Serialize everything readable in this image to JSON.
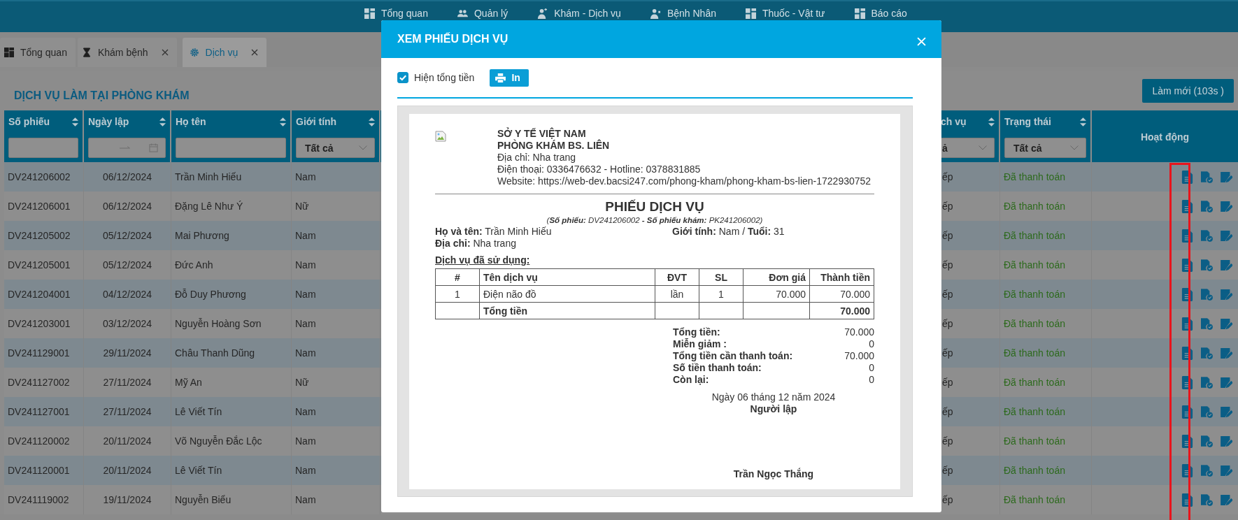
{
  "nav": [
    {
      "label": "Tổng quan"
    },
    {
      "label": "Quản lý"
    },
    {
      "label": "Khám - Dịch vụ"
    },
    {
      "label": "Bệnh Nhân"
    },
    {
      "label": "Thuốc - Vật tư"
    },
    {
      "label": "Báo cáo"
    }
  ],
  "tabs": [
    {
      "label": "Tổng quan",
      "selected": false,
      "closable": false
    },
    {
      "label": "Khám bệnh",
      "selected": false,
      "closable": true
    },
    {
      "label": "Dịch vụ",
      "selected": true,
      "closable": true
    }
  ],
  "page_title": "DỊCH VỤ LÀM TẠI PHÒNG KHÁM",
  "refresh_button": "Làm mới (103s )",
  "table": {
    "columns": [
      {
        "label": "Số phiếu",
        "kind": "text"
      },
      {
        "label": "Ngày lập",
        "kind": "date"
      },
      {
        "label": "Họ tên",
        "kind": "text"
      },
      {
        "label": "Giới tính",
        "kind": "select",
        "value": "Tất cả"
      },
      {
        "label": "ch vụ",
        "kind": "select",
        "value": "ả"
      },
      {
        "label": "Trạng thái",
        "kind": "select",
        "value": "Tất cả"
      },
      {
        "label": "Hoạt động",
        "kind": "plain"
      }
    ],
    "rows": [
      {
        "cells": [
          "DV241206002",
          "06/12/2024",
          "Trần Minh Hiếu",
          "Nam",
          "ếp",
          "Đã thanh toán"
        ]
      },
      {
        "cells": [
          "DV241206001",
          "06/12/2024",
          "Đặng Lê Như Ý",
          "Nữ",
          "ếp",
          "Đã thanh toán"
        ]
      },
      {
        "cells": [
          "DV241205002",
          "05/12/2024",
          "Mai Phương",
          "Nam",
          "ếp",
          "Đã thanh toán"
        ]
      },
      {
        "cells": [
          "DV241205001",
          "05/12/2024",
          "Đức Anh",
          "Nam",
          "ếp",
          "Đã thanh toán"
        ]
      },
      {
        "cells": [
          "DV241204001",
          "04/12/2024",
          "Đỗ Duy Phương",
          "Nam",
          "ếp",
          "Đã thanh toán"
        ]
      },
      {
        "cells": [
          "DV241203001",
          "03/12/2024",
          "Nguyễn Hoàng Sơn",
          "Nam",
          "ếp",
          "Đã thanh toán"
        ]
      },
      {
        "cells": [
          "DV241129001",
          "29/11/2024",
          "Châu Thanh Dũng",
          "Nam",
          "ếp",
          "Đã thanh toán"
        ]
      },
      {
        "cells": [
          "DV241127002",
          "27/11/2024",
          "Mỹ An",
          "Nữ",
          "ếp",
          "Đã thanh toán"
        ]
      },
      {
        "cells": [
          "DV241127001",
          "27/11/2024",
          "Lê Viết Tín",
          "Nam",
          "ếp",
          "Đã thanh toán"
        ]
      },
      {
        "cells": [
          "DV241120002",
          "20/11/2024",
          "Võ Nguyễn Đắc Lộc",
          "Nam",
          "ếp",
          "Đã thanh toán"
        ]
      },
      {
        "cells": [
          "DV241120001",
          "20/11/2024",
          "Lê Viết Tín",
          "Nam",
          "ếp",
          "Đã thanh toán"
        ]
      },
      {
        "cells": [
          "DV241119002",
          "19/11/2024",
          "Nguyễn Biểu",
          "Nam",
          "ếp",
          "Đã thanh toán"
        ]
      }
    ]
  },
  "modal": {
    "title": "XEM PHIẾU DỊCH VỤ",
    "show_total": {
      "label": "Hiện tổng tiền",
      "checked": true
    },
    "print_button": "In",
    "receipt": {
      "org_lines": [
        {
          "text": "SỞ Y TẾ VIỆT NAM",
          "bold": true
        },
        {
          "text": "PHÒNG KHÁM BS. LIÊN",
          "bold": true
        },
        {
          "text": "Địa chỉ: Nha trang",
          "bold": false
        },
        {
          "text": "Điện thoại: 0336476632 - Hotline: 0378831885",
          "bold": false
        },
        {
          "text": "Website: https://web-dev.bacsi247.com/phong-kham/phong-kham-bs-lien-1722930752",
          "bold": false
        }
      ],
      "title": "PHIẾU DỊCH VỤ",
      "subtitle": "(**Số phiếu:** DV241206002 **- Số phiếu khám:** PK241206002)",
      "patient_name": "**Họ và tên:** Trần Minh Hiếu",
      "gender_age": "**Giới tính:** Nam / **Tuổi:** 31",
      "address": "**Địa chỉ:** Nha trang",
      "services_heading": "Dịch vụ đã sử dụng:",
      "items": {
        "columns": [
          "#",
          "Tên dịch vụ",
          "ĐVT",
          "SL",
          "Đơn giá",
          "Thành tiền"
        ],
        "rows": [
          [
            "1",
            "Điện não đồ",
            "lần",
            "1",
            "70.000",
            "70.000"
          ]
        ],
        "total": {
          "label": "Tổng tiền",
          "value": "70.000"
        }
      },
      "summary": [
        {
          "label": "Tổng tiền:",
          "value": "70.000"
        },
        {
          "label": "Miễn giảm :",
          "value": "0"
        },
        {
          "label": "Tổng tiền cần thanh toán:",
          "value": "70.000"
        },
        {
          "label": "Số tiền thanh toán:",
          "value": "0"
        },
        {
          "label": "Còn lại:",
          "value": "0"
        }
      ],
      "date": "Ngày 06 tháng 12 năm 2024",
      "signer_title": "Người lập",
      "signer_name": "Trần Ngọc Thắng"
    }
  }
}
